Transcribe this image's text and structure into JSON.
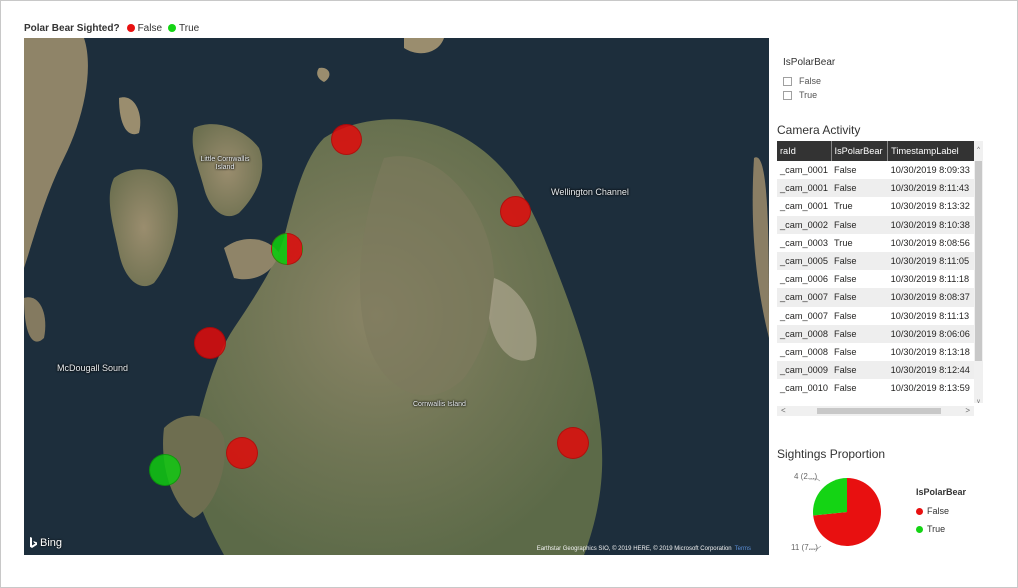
{
  "map_legend": {
    "title": "Polar Bear Sighted?",
    "items": [
      {
        "label": "False",
        "color": "#e81010"
      },
      {
        "label": "True",
        "color": "#14d414"
      }
    ]
  },
  "map": {
    "labels": {
      "wellington": "Wellington Channel",
      "mcdougall": "McDougall Sound",
      "cornwallis": "Cornwallis Island",
      "little_cornwallis": "Little Cornwallis Island"
    },
    "bing": "Bing",
    "attribution": "Earthstar Geographics SIO, © 2019 HERE, © 2019 Microsoft Corporation",
    "terms": "Terms"
  },
  "slicer": {
    "title": "IsPolarBear",
    "options": [
      "False",
      "True"
    ]
  },
  "table": {
    "title": "Camera Activity",
    "columns": [
      "raId",
      "IsPolarBear",
      "TimestampLabel"
    ],
    "rows": [
      [
        "_cam_0001",
        "False",
        "10/30/2019 8:09:33"
      ],
      [
        "_cam_0001",
        "False",
        "10/30/2019 8:11:43"
      ],
      [
        "_cam_0001",
        "True",
        "10/30/2019 8:13:32"
      ],
      [
        "_cam_0002",
        "False",
        "10/30/2019 8:10:38"
      ],
      [
        "_cam_0003",
        "True",
        "10/30/2019 8:08:56"
      ],
      [
        "_cam_0005",
        "False",
        "10/30/2019 8:11:05"
      ],
      [
        "_cam_0006",
        "False",
        "10/30/2019 8:11:18"
      ],
      [
        "_cam_0007",
        "False",
        "10/30/2019 8:08:37"
      ],
      [
        "_cam_0007",
        "False",
        "10/30/2019 8:11:13"
      ],
      [
        "_cam_0008",
        "False",
        "10/30/2019 8:06:06"
      ],
      [
        "_cam_0008",
        "False",
        "10/30/2019 8:13:18"
      ],
      [
        "_cam_0009",
        "False",
        "10/30/2019 8:12:44"
      ],
      [
        "_cam_0010",
        "False",
        "10/30/2019 8:13:59"
      ]
    ]
  },
  "pie": {
    "title": "Sightings Proportion",
    "chart_data": {
      "type": "pie",
      "categories": [
        "False",
        "True"
      ],
      "values": [
        11,
        4
      ],
      "colors": [
        "#e81010",
        "#14d414"
      ]
    },
    "label_true": "4 (2...)",
    "label_false": "11 (7...)",
    "legend_title": "IsPolarBear",
    "legend": [
      {
        "label": "False",
        "color": "#e81010"
      },
      {
        "label": "True",
        "color": "#14d414"
      }
    ]
  }
}
